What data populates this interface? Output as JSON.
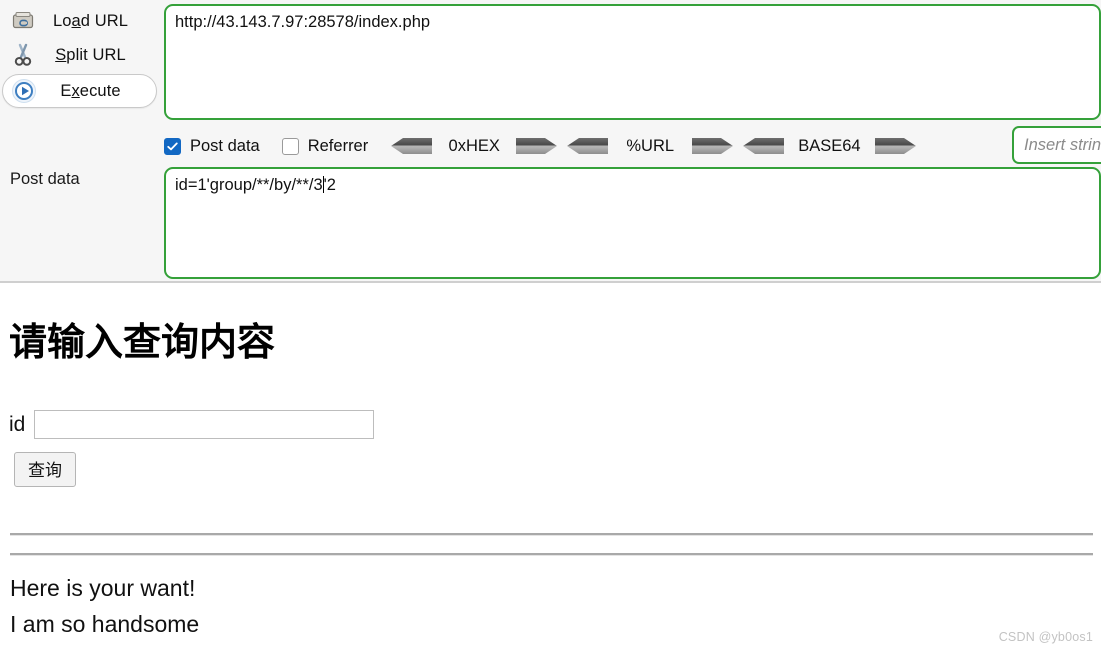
{
  "hackbar": {
    "commands": [
      {
        "label_pre": "Lo",
        "label_key": "a",
        "label_post": "d URL",
        "icon": "load-url-icon",
        "active": false
      },
      {
        "label_pre": "",
        "label_key": "S",
        "label_post": "plit URL",
        "icon": "scissors-icon",
        "active": false
      },
      {
        "label_pre": "E",
        "label_key": "x",
        "label_post": "ecute",
        "icon": "execute-play-icon",
        "active": true
      }
    ],
    "url_value": "http://43.143.7.97:28578/index.php",
    "post_label": "Post data",
    "post_value_before_caret": "id=1'group/**/by/**/3",
    "post_value_after_caret": "'2",
    "checkboxes": [
      {
        "label": "Post data",
        "checked": true
      },
      {
        "label": "Referrer",
        "checked": false
      }
    ],
    "encoders": [
      {
        "name": "0xHEX"
      },
      {
        "name": "%URL"
      },
      {
        "name": "BASE64"
      }
    ],
    "insert_placeholder": "Insert string...",
    "accent_border": "#35a13a",
    "checkbox_color": "#1268c3"
  },
  "page": {
    "title": "请输入查询内容",
    "id_label": "id",
    "id_value": "",
    "id_placeholder": "",
    "submit_label": "查询",
    "results": [
      "Here is your want!",
      "I am so handsome"
    ]
  },
  "watermark": "CSDN @yb0os1"
}
